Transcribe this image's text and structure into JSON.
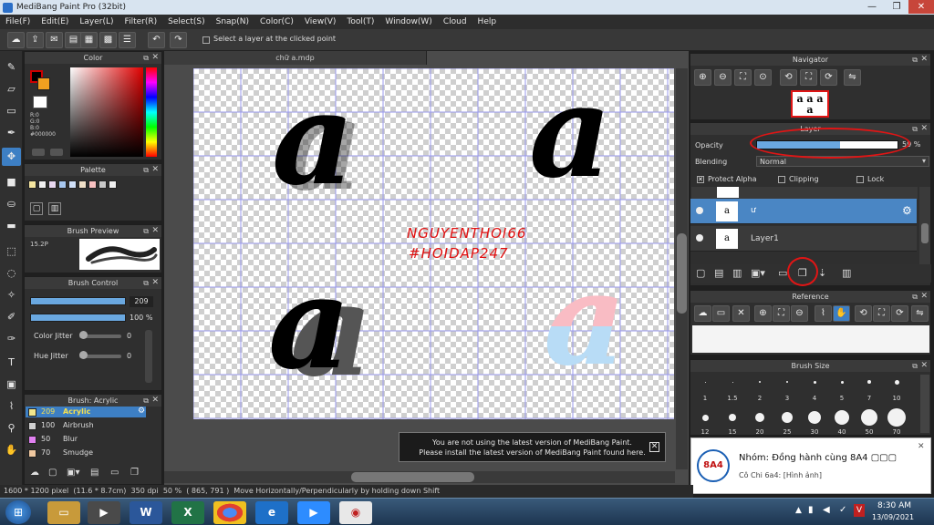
{
  "window": {
    "title": "MediBang Paint Pro (32bit)",
    "minimize": "—",
    "maximize": "❐",
    "close": "✕"
  },
  "menu": [
    "File(F)",
    "Edit(E)",
    "Layer(L)",
    "Filter(R)",
    "Select(S)",
    "Snap(N)",
    "Color(C)",
    "View(V)",
    "Tool(T)",
    "Window(W)",
    "Cloud",
    "Help"
  ],
  "toolbar": {
    "select_layer_label": "Select a layer at the clicked point"
  },
  "document": {
    "tab": "chữ a.mdp",
    "glyph": "a"
  },
  "watermark": {
    "line1": "NGUYENTHOI66",
    "line2": "#HOIDAP247"
  },
  "color_panel": {
    "title": "Color",
    "r": "R:0",
    "g": "G:0",
    "b": "B:0",
    "hex": "#000000",
    "colors": {
      "foreground": "#000000",
      "secondary": "#f0a020",
      "accent": "#3d7fc4"
    }
  },
  "palette_panel": {
    "title": "Palette",
    "swatches": [
      "#f5e6a0",
      "#f0f0f0",
      "#e8d8f0",
      "#a8c8f0",
      "#d0e0f8",
      "#f0e0c8",
      "#f8c0c0",
      "#c8c8c8",
      "#f0f0f0"
    ]
  },
  "brush_preview": {
    "title": "Brush Preview",
    "size": "15.2P"
  },
  "brush_control": {
    "title": "Brush Control",
    "size_value": "209",
    "opacity_value": "100 %",
    "color_jitter_label": "Color Jitter",
    "color_jitter_value": "0",
    "hue_jitter_label": "Hue Jitter",
    "hue_jitter_value": "0"
  },
  "brush_list": {
    "title": "Brush: Acrylic",
    "items": [
      {
        "size": "209",
        "name": "Acrylic",
        "color": "#f0e68c"
      },
      {
        "size": "100",
        "name": "Airbrush",
        "color": "#d0d0d0"
      },
      {
        "size": "50",
        "name": "Blur",
        "color": "#e080f0"
      },
      {
        "size": "70",
        "name": "Smudge",
        "color": "#f0c8a0"
      }
    ]
  },
  "navigator": {
    "title": "Navigator",
    "thumb_glyphs": "a a a a"
  },
  "layer_panel": {
    "title": "Layer",
    "opacity_label": "Opacity",
    "opacity_value": "59 %",
    "opacity_fraction": 0.59,
    "blending_label": "Blending",
    "blending_value": "Normal",
    "protect_alpha_label": "Protect Alpha",
    "clipping_label": "Clipping",
    "lock_label": "Lock",
    "layers": [
      {
        "name": "ư",
        "selected": true
      },
      {
        "name": "Layer1",
        "selected": false
      }
    ]
  },
  "reference": {
    "title": "Reference"
  },
  "brush_size": {
    "title": "Brush Size",
    "row1": [
      "1",
      "1.5",
      "2",
      "3",
      "4",
      "5",
      "7",
      "10"
    ],
    "row2": [
      "12",
      "15",
      "20",
      "25",
      "30",
      "40",
      "50",
      "70"
    ]
  },
  "notice": {
    "line1": "You are not using the latest version of MediBang Paint.",
    "line2": "Please install the latest version of MediBang Paint found here.",
    "close": "✕"
  },
  "statusbar": {
    "dims": "1600 * 1200 pixel",
    "cm": "(11.6 * 8.7cm)",
    "dpi": "350 dpi",
    "zoom": "50 %",
    "coords": "( 865, 791 )",
    "hint": "Move Horizontally/Perpendicularly by holding down Shift"
  },
  "notification": {
    "title": "Nhóm: Đồng hành cùng 8A4 ▢▢▢",
    "subtitle": "Cô Chi 6a4: [Hình ảnh]",
    "badge": "8A4",
    "close": "✕"
  },
  "taskbar": {
    "time": "8:30 AM",
    "date": "13/09/2021",
    "start_icon": "⊞",
    "word_label": "W",
    "excel_label": "X",
    "tray_v": "V"
  }
}
